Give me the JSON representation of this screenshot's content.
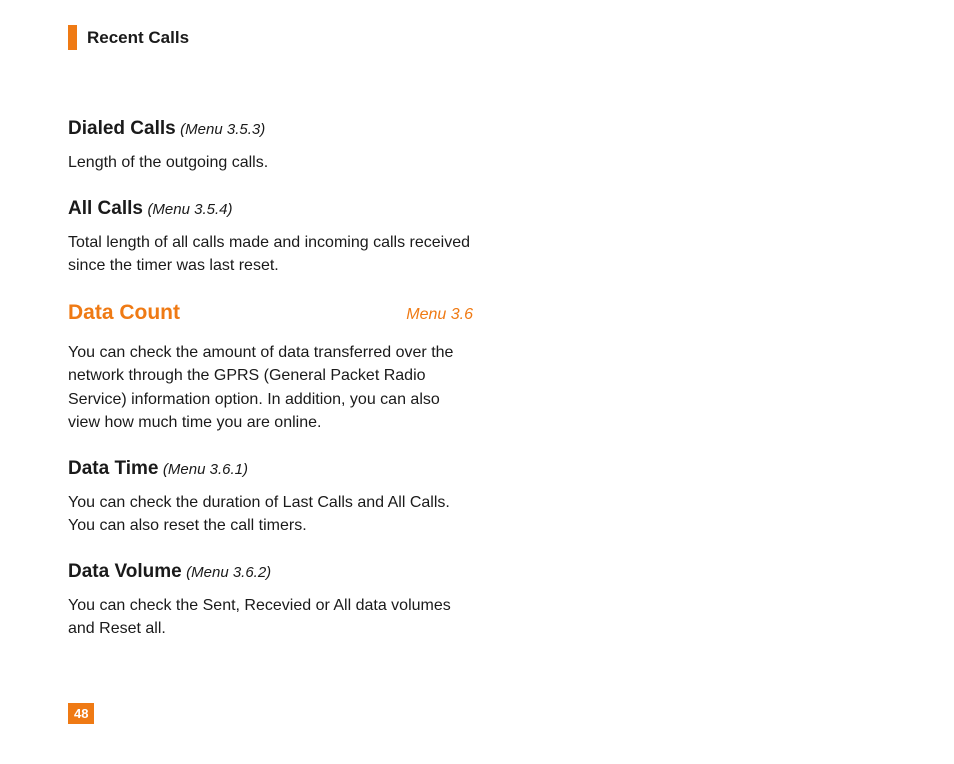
{
  "header": {
    "title": "Recent Calls"
  },
  "sections": [
    {
      "heading": "Dialed Calls",
      "menuRef": "(Menu 3.5.3)",
      "body": "Length of the outgoing calls."
    },
    {
      "heading": "All Calls",
      "menuRef": "(Menu 3.5.4)",
      "body": "Total length of all calls made and incoming calls received since the timer was last reset."
    }
  ],
  "majorSection": {
    "heading": "Data Count",
    "menuRef": "Menu 3.6",
    "body": "You can check the amount of data transferred over the network through the GPRS (General Packet Radio Service) information option. In addition, you can also view how much time you are online.",
    "subsections": [
      {
        "heading": "Data Time",
        "menuRef": "(Menu 3.6.1)",
        "body": "You can check the duration of Last Calls and All Calls. You can also reset the call timers."
      },
      {
        "heading": "Data Volume",
        "menuRef": "(Menu 3.6.2)",
        "body": "You can check the Sent, Recevied or All data volumes and Reset all."
      }
    ]
  },
  "pageNumber": "48",
  "colors": {
    "accent": "#ef7a14"
  }
}
